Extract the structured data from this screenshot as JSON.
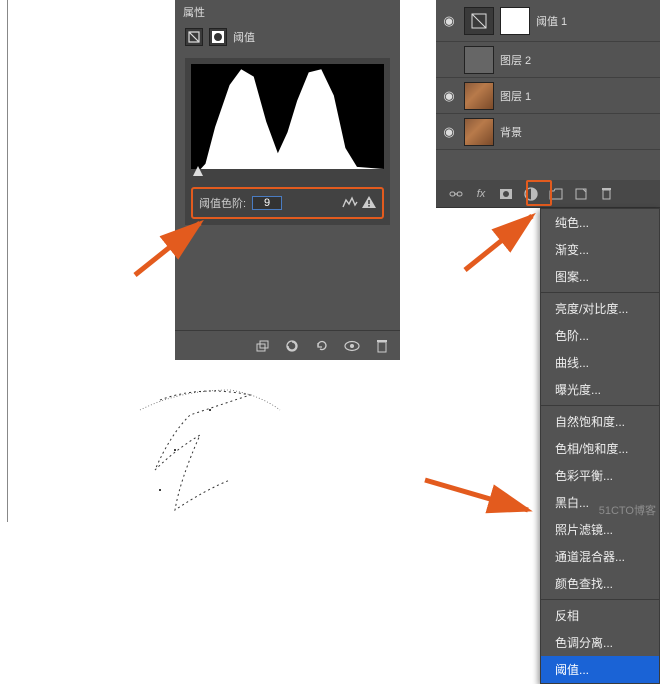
{
  "props": {
    "title": "属性",
    "adj_name": "阈值",
    "threshold_label": "阈值色阶:",
    "threshold_value": "9"
  },
  "layers": {
    "items": [
      {
        "name": "阈值 1",
        "type": "adjustment"
      },
      {
        "name": "图层 2",
        "type": "grey"
      },
      {
        "name": "图层 1",
        "type": "image"
      },
      {
        "name": "背景",
        "type": "image"
      }
    ]
  },
  "ctx": {
    "groups": [
      [
        "纯色...",
        "渐变...",
        "图案..."
      ],
      [
        "亮度/对比度...",
        "色阶...",
        "曲线...",
        "曝光度..."
      ],
      [
        "自然饱和度...",
        "色相/饱和度...",
        "色彩平衡...",
        "黑白...",
        "照片滤镜...",
        "通道混合器...",
        "颜色查找..."
      ],
      [
        "反相",
        "色调分离...",
        "阈值..."
      ]
    ],
    "selected": "阈值..."
  },
  "watermark": "51CTO博客"
}
